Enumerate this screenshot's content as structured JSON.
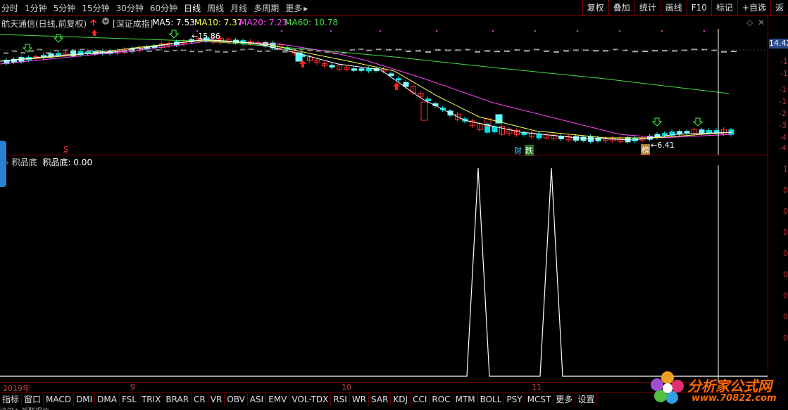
{
  "toolbar": {
    "periods": [
      "分时",
      "1分钟",
      "5分钟",
      "15分钟",
      "30分钟",
      "60分钟",
      "日线",
      "周线",
      "月线",
      "多周期",
      "更多"
    ],
    "active": "日线",
    "more_icon": "chevron-right-icon",
    "right_buttons": [
      "复权",
      "叠加",
      "统计",
      "画线",
      "F10",
      "标记",
      "+自选",
      "返"
    ]
  },
  "info": {
    "stock": "航天通信(日线,前复权)",
    "index": "[深证成指]",
    "ma5_label": "MA5: 7.53",
    "ma10_label": "MA10: 7.37",
    "ma20_label": "MA20: 7.23",
    "ma60_label": "MA60: 10.78",
    "colors": {
      "ma5": "#ffffff",
      "ma10": "#ffff55",
      "ma20": "#ff44ff",
      "ma60": "#44dd44"
    }
  },
  "annotations": {
    "high": "15.86",
    "low": "6.41",
    "cai": "财",
    "die": "跌",
    "bang": "榜",
    "s_mark": "S"
  },
  "price_badge": "14.42",
  "indicator": {
    "name": "积品底",
    "label": "积品底:",
    "value": "0.00"
  },
  "yaxis_top": [
    "-1",
    "-1",
    "-1",
    "-1",
    "-2",
    "-3",
    "-4",
    "-4"
  ],
  "yaxis_bottom": [
    "1",
    "0",
    "0",
    "0",
    "0",
    "0",
    "0",
    "0",
    "0"
  ],
  "dates": [
    "2019年",
    "9",
    "10",
    "11"
  ],
  "bottom_tabs": [
    "指标",
    "窗口",
    "MACD",
    "DMI",
    "DMA",
    "FSL",
    "TRIX",
    "BRAR",
    "CR",
    "VR",
    "OBV",
    "ASI",
    "EMV",
    "VOL-TDX",
    "RSI",
    "WR",
    "SAR",
    "KDJ",
    "CCI",
    "ROC",
    "MTM",
    "BOLL",
    "PSY",
    "MCST",
    "更多",
    "设置"
  ],
  "status": "沪深A  关联报价",
  "logo": {
    "text": "分析家公式网",
    "url": "www.70822.com"
  }
}
